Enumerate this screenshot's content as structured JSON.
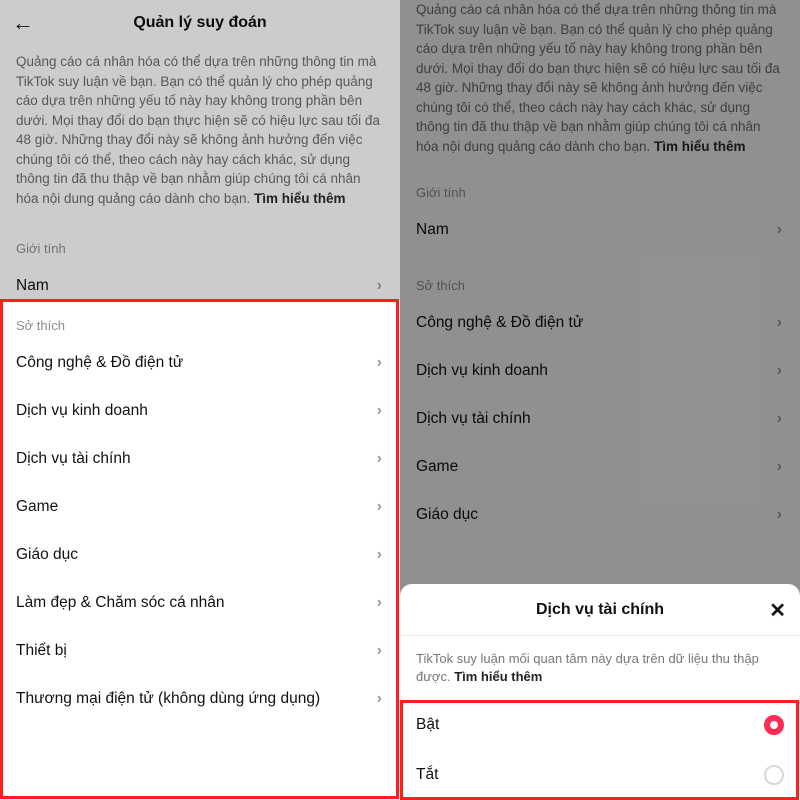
{
  "left": {
    "title": "Quản lý suy đoán",
    "description_main": "Quảng cáo cá nhân hóa có thể dựa trên những thông tin mà TikTok suy luận về bạn. Bạn có thể quản lý cho phép quảng cáo dựa trên những yếu tố này hay không trong phần bên dưới. Mọi thay đổi do bạn thực hiện sẽ có hiệu lực sau tối đa 48 giờ. Những thay đổi này sẽ không ảnh hưởng đến việc chúng tôi có thể, theo cách này hay cách khác, sử dụng thông tin đã thu thập về bạn nhằm giúp chúng tôi cá nhân hóa nội dung quảng cáo dành cho bạn. ",
    "learn_more": "Tìm hiểu thêm",
    "gender_label": "Giới tính",
    "gender_value": "Nam",
    "interests_label": "Sở thích",
    "interests": [
      "Công nghệ & Đồ điện tử",
      "Dịch vụ kinh doanh",
      "Dịch vụ tài chính",
      "Game",
      "Giáo dục",
      "Làm đẹp & Chăm sóc cá nhân",
      "Thiết bị",
      "Thương mại điện tử (không dùng ứng dụng)"
    ]
  },
  "right": {
    "description_main": "Quảng cáo cá nhân hóa có thể dựa trên những thông tin mà TikTok suy luận về bạn. Bạn có thể quản lý cho phép quảng cáo dựa trên những yếu tố này hay không trong phần bên dưới. Mọi thay đổi do bạn thực hiện sẽ có hiệu lực sau tối đa 48 giờ. Những thay đổi này sẽ không ảnh hưởng đến việc chúng tôi có thể, theo cách này hay cách khác, sử dụng thông tin đã thu thập về bạn nhằm giúp chúng tôi cá nhân hóa nội dung quảng cáo dành cho bạn. ",
    "learn_more": "Tìm hiểu thêm",
    "gender_label": "Giới tính",
    "gender_value": "Nam",
    "interests_label": "Sở thích",
    "interests": [
      "Công nghệ & Đồ điện tử",
      "Dịch vụ kinh doanh",
      "Dịch vụ tài chính",
      "Game",
      "Giáo dục"
    ],
    "sheet": {
      "title": "Dịch vụ tài chính",
      "desc_main": "TikTok suy luận mối quan tâm này dựa trên dữ liệu thu thập được. ",
      "learn_more": "Tìm hiểu thêm",
      "option_on": "Bật",
      "option_off": "Tắt"
    }
  }
}
